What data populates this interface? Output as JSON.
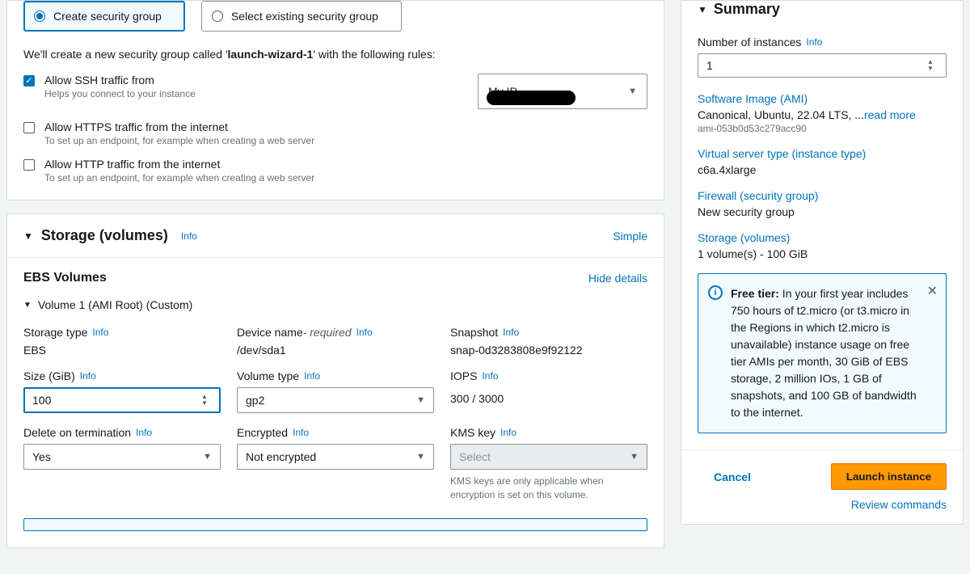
{
  "sg": {
    "create_label": "Create security group",
    "select_label": "Select existing security group",
    "intro_pre": "We'll create a new security group called '",
    "intro_name": "launch-wizard-1",
    "intro_post": "' with the following rules:",
    "ssh": {
      "label": "Allow SSH traffic from",
      "help": "Helps you connect to your instance",
      "source": "My IP"
    },
    "https": {
      "label": "Allow HTTPS traffic from the internet",
      "help": "To set up an endpoint, for example when creating a web server"
    },
    "http": {
      "label": "Allow HTTP traffic from the internet",
      "help": "To set up an endpoint, for example when creating a web server"
    }
  },
  "storage": {
    "title": "Storage (volumes)",
    "info": "Info",
    "simple": "Simple",
    "ebs_title": "EBS Volumes",
    "hide": "Hide details",
    "vol_title": "Volume 1 (AMI Root) (Custom)",
    "fields": {
      "storage_type": {
        "label": "Storage type",
        "value": "EBS"
      },
      "device_name": {
        "label": "Device name",
        "req": " - required",
        "value": "/dev/sda1"
      },
      "snapshot": {
        "label": "Snapshot",
        "value": "snap-0d3283808e9f92122"
      },
      "size": {
        "label": "Size (GiB)",
        "value": "100"
      },
      "vol_type": {
        "label": "Volume type",
        "value": "gp2"
      },
      "iops": {
        "label": "IOPS",
        "value": "300 / 3000"
      },
      "dot": {
        "label": "Delete on termination",
        "value": "Yes"
      },
      "enc": {
        "label": "Encrypted",
        "value": "Not encrypted"
      },
      "kms": {
        "label": "KMS key",
        "value": "Select",
        "help": "KMS keys are only applicable when encryption is set on this volume."
      }
    }
  },
  "summary": {
    "title": "Summary",
    "num_label": "Number of instances",
    "num_value": "1",
    "ami": {
      "h": "Software Image (AMI)",
      "v": "Canonical, Ubuntu, 22.04 LTS, ...",
      "read": "read more",
      "sub": "ami-053b0d53c279acc90"
    },
    "itype": {
      "h": "Virtual server type (instance type)",
      "v": "c6a.4xlarge"
    },
    "fw": {
      "h": "Firewall (security group)",
      "v": "New security group"
    },
    "stor": {
      "h": "Storage (volumes)",
      "v": "1 volume(s) - 100 GiB"
    },
    "free": {
      "bold": "Free tier:",
      "text": " In your first year includes 750 hours of t2.micro (or t3.micro in the Regions in which t2.micro is unavailable) instance usage on free tier AMIs per month, 30 GiB of EBS storage, 2 million IOs, 1 GB of snapshots, and 100 GB of bandwidth to the internet."
    },
    "cancel": "Cancel",
    "launch": "Launch instance",
    "review": "Review commands"
  },
  "info": "Info"
}
